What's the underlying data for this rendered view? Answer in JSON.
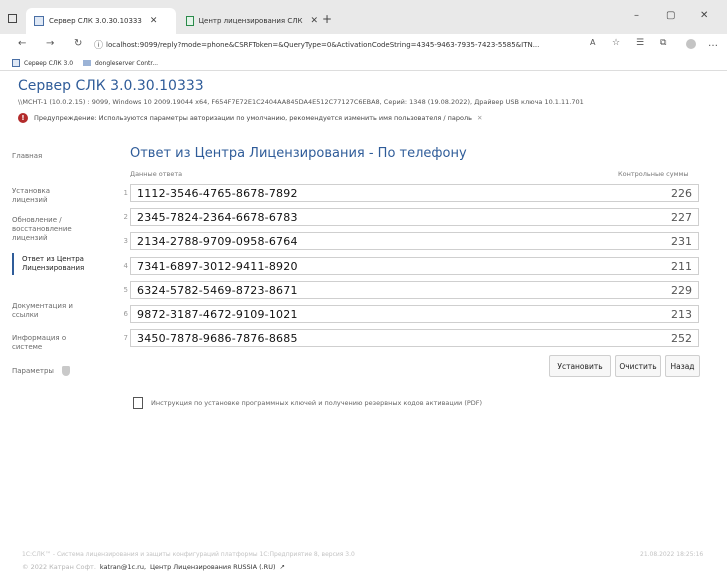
{
  "browser": {
    "tabs": [
      {
        "label": "Сервер СЛК 3.0.30.10333",
        "active": true
      },
      {
        "label": "Центр лицензирования СЛК",
        "active": false
      }
    ],
    "new_tab": "+",
    "address": "localhost:9099/reply?mode=phone&CSRFToken=&QueryType=0&ActivationCodeString=4345-9463-7935-7423-5585&ITN...",
    "window_controls": {
      "min": "–",
      "max": "▢",
      "close": "✕"
    },
    "bookmarks": [
      {
        "label": "Сервер СЛК 3.0"
      },
      {
        "label": "dongleserver Contr..."
      }
    ]
  },
  "page": {
    "title": "Сервер СЛК 3.0.30.10333",
    "subinfo": "\\\\MCHT-1 (10.0.2.15) : 9099,  Windows 10 2009.19044 x64,  F654F7E72E1C2404AA845DA4E512C77127C6EBA8,  Серий: 1348 (19.08.2022),  Драйвер USB ключа 10.1.11.701",
    "warning": "Предупреждение: Используются параметры авторизации по умолчанию, рекомендуется изменить имя пользователя / пароль",
    "warning_close": "✕"
  },
  "sidebar": {
    "items": [
      {
        "label": "Главная"
      },
      {
        "label": "Установка лицензий"
      },
      {
        "label": "Обновление / восстановление лицензий"
      },
      {
        "label": "Ответ из Центра Лицензирования"
      },
      {
        "label": "Документация и ссылки"
      },
      {
        "label": "Информация о системе"
      },
      {
        "label": "Параметры"
      }
    ]
  },
  "main": {
    "heading": "Ответ из Центра Лицензирования - По телефону",
    "col_data": "Данные ответа",
    "col_sums": "Контрольные суммы",
    "rows": [
      {
        "num": "1",
        "code": "1112-3546-4765-8678-7892",
        "sum": "226"
      },
      {
        "num": "2",
        "code": "2345-7824-2364-6678-6783",
        "sum": "227"
      },
      {
        "num": "3",
        "code": "2134-2788-9709-0958-6764",
        "sum": "231"
      },
      {
        "num": "4",
        "code": "7341-6897-3012-9411-8920",
        "sum": "211"
      },
      {
        "num": "5",
        "code": "6324-5782-5469-8723-8671",
        "sum": "229"
      },
      {
        "num": "6",
        "code": "9872-3187-4672-9109-1021",
        "sum": "213"
      },
      {
        "num": "7",
        "code": "3450-7878-9686-7876-8685",
        "sum": "252"
      }
    ],
    "buttons": {
      "install": "Установить",
      "clear": "Очистить",
      "back": "Назад"
    },
    "pdf_link": "Инструкция по установке программных ключей и получению резервных кодов активации (PDF)"
  },
  "footer": {
    "line1": "1C:СЛК™ - Система лицензирования и защиты конфигураций платформы 1С:Предприятие 8, версия 3.0",
    "date": "21.08.2022 18:25:16",
    "copyright": "© 2022 Катран Софт.",
    "email": "katran@1c.ru,",
    "center": "Центр Лицензирования RUSSIA (.RU)"
  }
}
